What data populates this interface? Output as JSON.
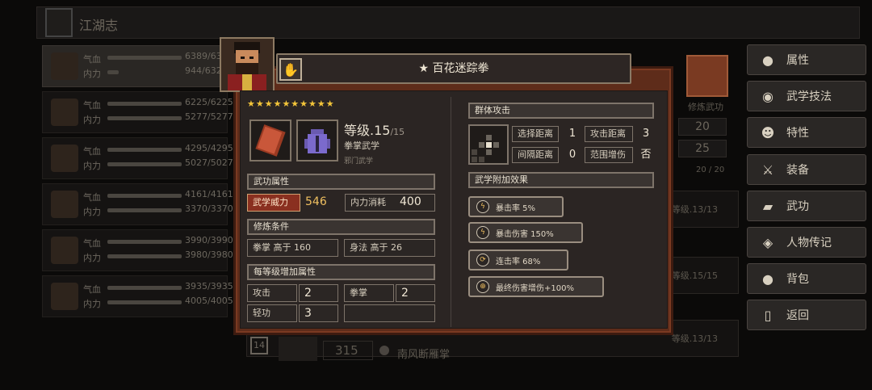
{
  "window": {
    "title": "江湖志"
  },
  "roster": [
    {
      "hp_label": "气血",
      "hp": "6389/6389",
      "mp_label": "内力",
      "mp": "944/6329"
    },
    {
      "hp_label": "气血",
      "hp": "6225/6225",
      "mp_label": "内力",
      "mp": "5277/5277"
    },
    {
      "hp_label": "气血",
      "hp": "4295/4295",
      "mp_label": "内力",
      "mp": "5027/5027"
    },
    {
      "hp_label": "气血",
      "hp": "4161/4161",
      "mp_label": "内力",
      "mp": "3370/3370"
    },
    {
      "hp_label": "气血",
      "hp": "3990/3990",
      "mp_label": "内力",
      "mp": "3980/3980"
    },
    {
      "hp_label": "气血",
      "hp": "3935/3935",
      "mp_label": "内力",
      "mp": "4005/4005"
    }
  ],
  "sidebar": [
    {
      "label": "属性",
      "icon": "person-icon"
    },
    {
      "label": "武学技法",
      "icon": "person-gear-icon"
    },
    {
      "label": "特性",
      "icon": "person-star-icon"
    },
    {
      "label": "装备",
      "icon": "sword-icon"
    },
    {
      "label": "武功",
      "icon": "book-icon"
    },
    {
      "label": "人物传记",
      "icon": "scroll-icon"
    },
    {
      "label": "背包",
      "icon": "bag-icon"
    },
    {
      "label": "返回",
      "icon": "door-icon"
    }
  ],
  "background": {
    "practice_label": "修炼武功",
    "num1": "20",
    "num2": "25",
    "progress": "20 / 20",
    "card_levels": [
      "等级.13/13",
      "等级.15/15",
      "等级.13/13"
    ],
    "bottom_badge": "14",
    "bottom_value": "315",
    "bottom_name": "南风断雁掌"
  },
  "skill": {
    "title": "★ 百花迷踪拳",
    "stars": "★★★★★★★★★★",
    "level_label": "等级.",
    "level": "15",
    "level_max": "/15",
    "type": "拳掌武学",
    "school": "邪门武学",
    "sections": {
      "attr": "武功属性",
      "req": "修炼条件",
      "per_level": "每等级增加属性",
      "area": "群体攻击",
      "effects": "武学附加效果"
    },
    "power_label": "武学威力",
    "power": "546",
    "cost_label": "内力消耗",
    "cost": "400",
    "req1": "拳掌 高于 160",
    "req2": "身法 高于 26",
    "bonus": [
      {
        "label": "攻击",
        "value": "2"
      },
      {
        "label": "拳掌",
        "value": "2"
      },
      {
        "label": "轻功",
        "value": "3"
      }
    ],
    "select_range_label": "选择距离",
    "select_range": "1",
    "attack_range_label": "攻击距离",
    "attack_range": "3",
    "interval_label": "间隔距离",
    "interval": "0",
    "aoe_boost_label": "范围增伤",
    "aoe_boost": "否",
    "effect_list": [
      {
        "icon": "lightning-icon",
        "text": "暴击率 5%"
      },
      {
        "icon": "lightning-icon",
        "text": "暴击伤害 150%"
      },
      {
        "icon": "combo-icon",
        "text": "连击率 68%"
      },
      {
        "icon": "target-icon",
        "text": "最终伤害增伤+100%"
      }
    ]
  }
}
